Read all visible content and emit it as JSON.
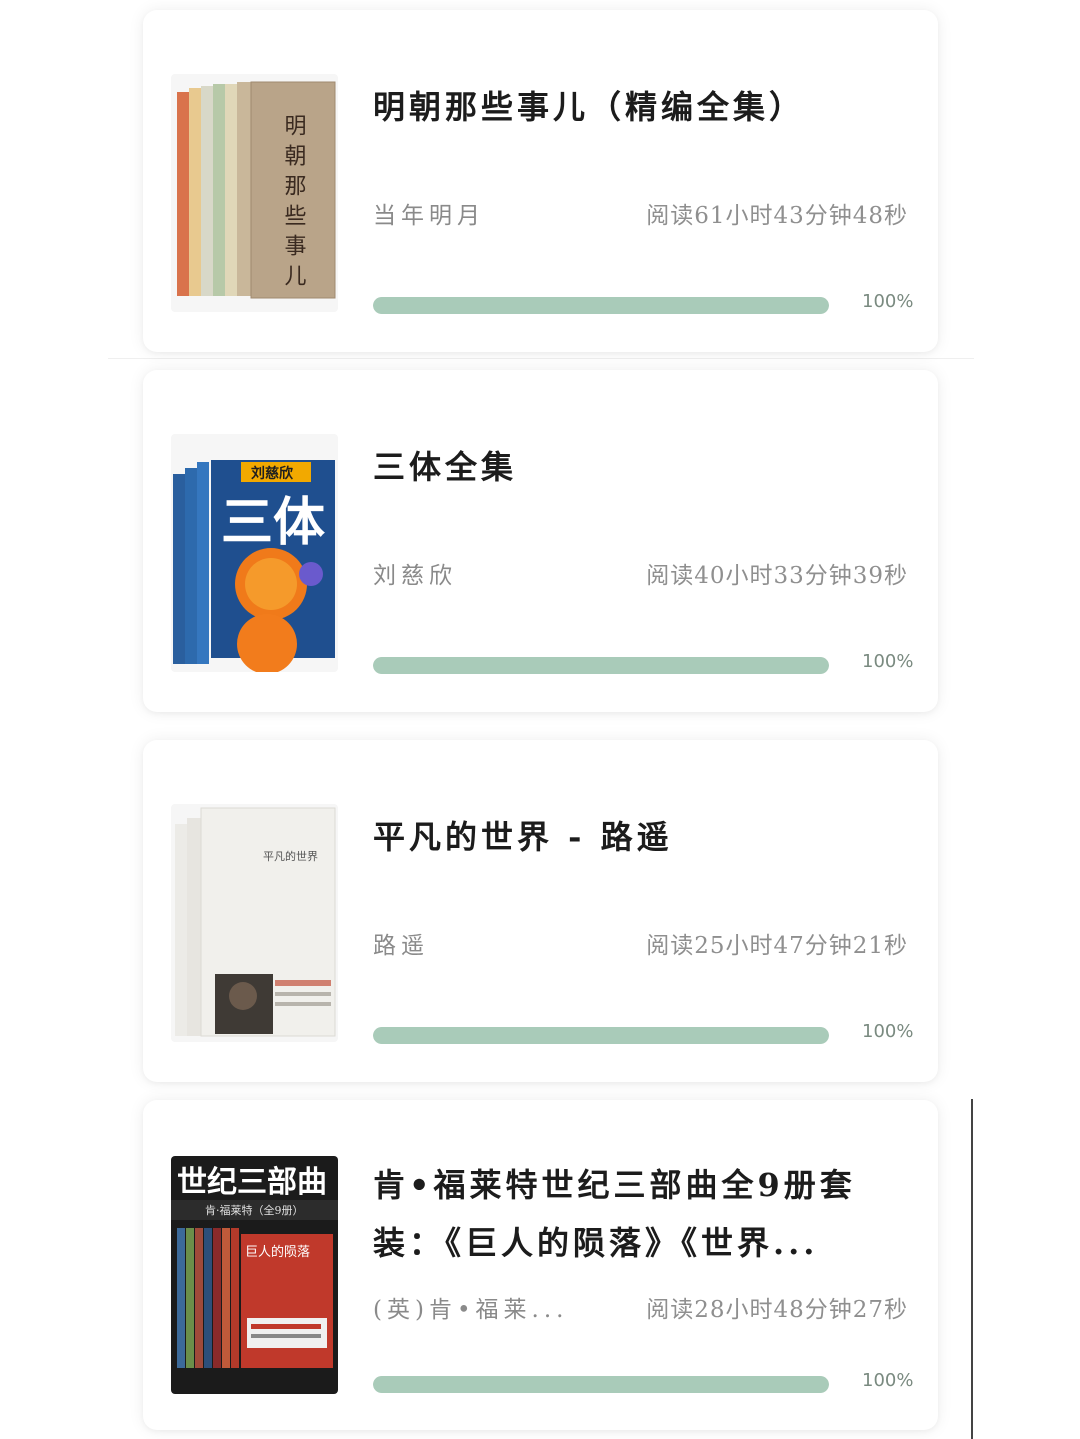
{
  "books": [
    {
      "title_lines": [
        "明朝那些事儿（精编全集）"
      ],
      "author": "当年明月",
      "read_time": "阅读61小时43分钟48秒",
      "progress_fraction": 1.0,
      "progress_label": "100%",
      "cover_text": "明朝那些事儿"
    },
    {
      "title_lines": [
        "三体全集"
      ],
      "author": "刘慈欣",
      "read_time": "阅读40小时33分钟39秒",
      "progress_fraction": 1.0,
      "progress_label": "100%",
      "cover_text_author": "刘慈欣",
      "cover_text": "三体"
    },
    {
      "title_lines": [
        "平凡的世界 - 路遥"
      ],
      "author": "路遥",
      "read_time": "阅读25小时47分钟21秒",
      "progress_fraction": 1.0,
      "progress_label": "100%",
      "cover_text": "平凡的世界"
    },
    {
      "title_lines": [
        "肯•福莱特世纪三部曲全9册套",
        "装：《巨人的陨落》《世界..."
      ],
      "author": "(英)肯•福莱...",
      "read_time": "阅读28小时48分钟27秒",
      "progress_fraction": 1.0,
      "progress_label": "100%",
      "cover_text": "世纪三部曲",
      "cover_subtext": "肯·福莱特（全9册）",
      "cover_book_title": "巨人的陨落"
    }
  ],
  "colors": {
    "progress_fill": "#a9cbb9",
    "progress_track": "#e6eee9",
    "title": "#1c1c1c",
    "meta": "#8a8a8a"
  }
}
